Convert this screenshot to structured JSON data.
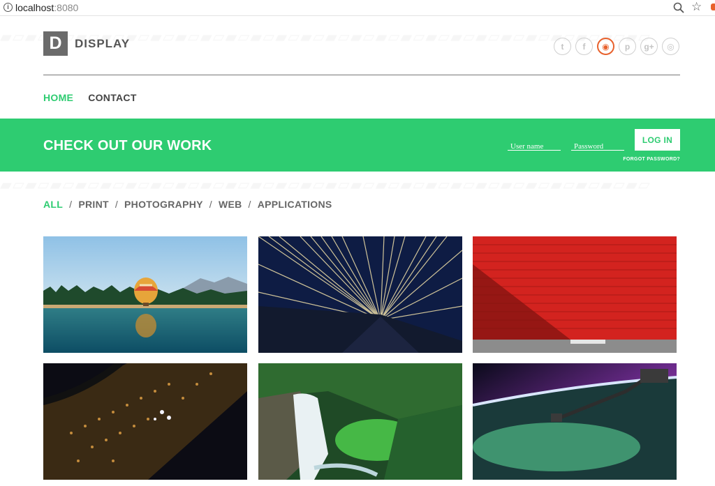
{
  "browser": {
    "url_host": "localhost",
    "url_port": ":8080"
  },
  "brand": {
    "logo_letter": "D",
    "name": "DISPLAY"
  },
  "social": [
    {
      "icon": "twitter-icon",
      "glyph": "t",
      "active": false
    },
    {
      "icon": "facebook-icon",
      "glyph": "f",
      "active": false
    },
    {
      "icon": "rss-icon",
      "glyph": "◉",
      "active": true
    },
    {
      "icon": "pinterest-icon",
      "glyph": "p",
      "active": false
    },
    {
      "icon": "google-plus-icon",
      "glyph": "g+",
      "active": false
    },
    {
      "icon": "dribbble-icon",
      "glyph": "◎",
      "active": false
    }
  ],
  "nav": {
    "home": "HOME",
    "contact": "CONTACT"
  },
  "band": {
    "headline": "CHECK OUT OUR WORK",
    "username_placeholder": "User name",
    "password_placeholder": "Password",
    "login_label": "LOG IN",
    "forgot_label": "FORGOT PASSWORD?"
  },
  "filters": {
    "all": "ALL",
    "print": "PRINT",
    "photography": "PHOTOGRAPHY",
    "web": "WEB",
    "applications": "APPLICATIONS",
    "separator": "/"
  },
  "colors": {
    "accent": "#2ecc71",
    "rss": "#e8612c",
    "logo_bg": "#6b6b6b"
  },
  "gallery": [
    {
      "subject": "hot-air-balloon-over-lake"
    },
    {
      "subject": "light-streaks-over-building"
    },
    {
      "subject": "red-wall"
    },
    {
      "subject": "city-lights-aerial"
    },
    {
      "subject": "waterfall-forest"
    },
    {
      "subject": "earth-aurora-from-space"
    }
  ]
}
